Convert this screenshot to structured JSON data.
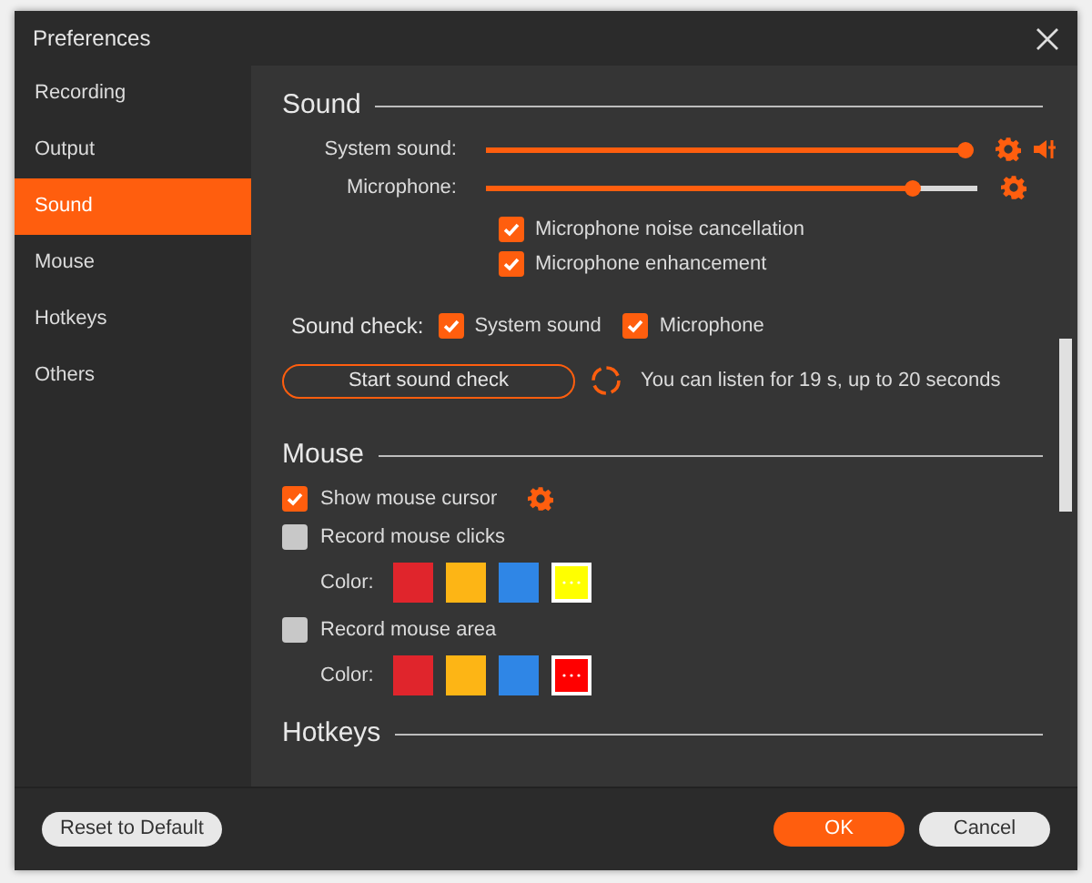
{
  "window": {
    "title": "Preferences"
  },
  "sidebar": {
    "items": [
      {
        "label": "Recording",
        "selected": false
      },
      {
        "label": "Output",
        "selected": false
      },
      {
        "label": "Sound",
        "selected": true
      },
      {
        "label": "Mouse",
        "selected": false
      },
      {
        "label": "Hotkeys",
        "selected": false
      },
      {
        "label": "Others",
        "selected": false
      }
    ]
  },
  "sound": {
    "heading": "Sound",
    "sliders": [
      {
        "label": "System sound:",
        "level": 0.99,
        "mixer": true
      },
      {
        "label": "Microphone:",
        "level": 0.87,
        "mixer": false
      }
    ],
    "options": [
      {
        "label": "Microphone noise cancellation",
        "checked": true
      },
      {
        "label": "Microphone enhancement",
        "checked": true
      }
    ],
    "sound_check": {
      "label": "Sound check:",
      "options": [
        {
          "label": "System sound",
          "checked": true
        },
        {
          "label": "Microphone",
          "checked": true
        }
      ]
    },
    "start_button": "Start sound check",
    "hint": "You can listen for 19 s, up to 20 seconds"
  },
  "mouse": {
    "heading": "Mouse",
    "options": [
      {
        "label": "Show mouse cursor",
        "checked": true,
        "settings": true
      },
      {
        "label": "Record mouse clicks",
        "checked": false,
        "settings": false,
        "color_label": "Color:",
        "colors": [
          {
            "color": "#e0252c",
            "selected": false
          },
          {
            "color": "#fdb515",
            "selected": false
          },
          {
            "color": "#2f86e6",
            "selected": false
          },
          {
            "color": "#ffff00",
            "selected": true
          }
        ]
      },
      {
        "label": "Record mouse area",
        "checked": false,
        "settings": false,
        "color_label": "Color:",
        "colors": [
          {
            "color": "#e0252c",
            "selected": false
          },
          {
            "color": "#fdb515",
            "selected": false
          },
          {
            "color": "#2f86e6",
            "selected": false
          },
          {
            "color": "#ff0000",
            "selected": true
          }
        ]
      }
    ]
  },
  "hotkeys": {
    "heading": "Hotkeys"
  },
  "footer": {
    "reset": "Reset to Default",
    "ok": "OK",
    "cancel": "Cancel"
  }
}
